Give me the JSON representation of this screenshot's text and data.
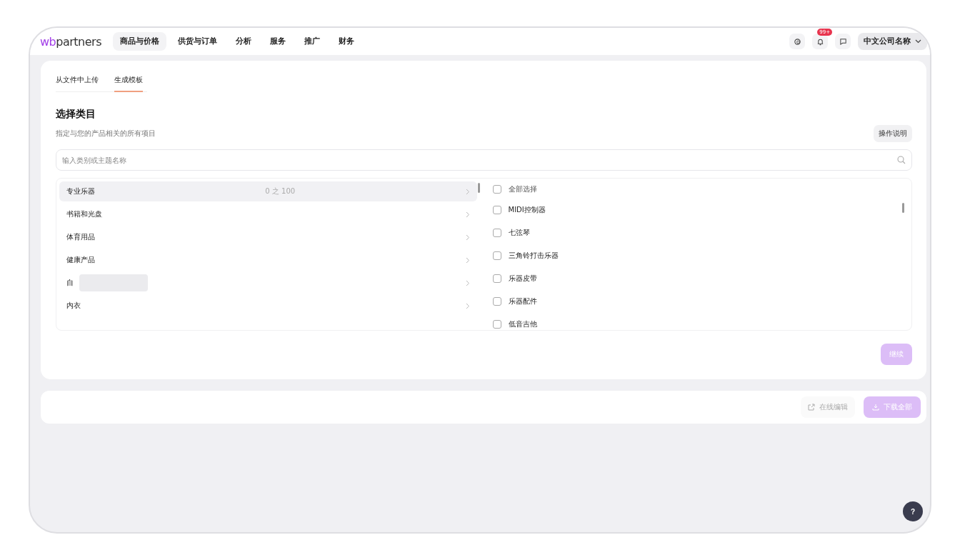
{
  "header": {
    "logo": {
      "first": "wb",
      "rest": "partners"
    },
    "nav": [
      {
        "label": "商品与价格",
        "selected": true
      },
      {
        "label": "供货与订单",
        "selected": false
      },
      {
        "label": "分析",
        "selected": false
      },
      {
        "label": "服务",
        "selected": false
      },
      {
        "label": "推广",
        "selected": false
      },
      {
        "label": "财务",
        "selected": false
      }
    ],
    "notification_badge": "99+",
    "account": "中文公司名称"
  },
  "tabs": [
    {
      "label": "从文件中上传",
      "selected": false
    },
    {
      "label": "生成模板",
      "selected": true
    }
  ],
  "section": {
    "title": "选择类目",
    "subtitle": "指定与您的产品相关的所有项目",
    "help_button": "操作说明"
  },
  "search": {
    "placeholder": "输入类别或主题名称"
  },
  "categories": [
    {
      "label": "专业乐器",
      "selected": true,
      "count": "0 之 100"
    },
    {
      "label": "书籍和光盘",
      "selected": false
    },
    {
      "label": "体育用品",
      "selected": false
    },
    {
      "label": "健康产品",
      "selected": false
    },
    {
      "label": "自",
      "selected": false,
      "redacted": true
    },
    {
      "label": "内衣",
      "selected": false
    }
  ],
  "subcategories": [
    {
      "label": "全部选择",
      "checked": false,
      "kind": "all"
    },
    {
      "label": "MIDI控制器",
      "checked": false,
      "kind": "item"
    },
    {
      "label": "七弦琴",
      "checked": false,
      "kind": "item"
    },
    {
      "label": "三角铃打击乐器",
      "checked": false,
      "kind": "item"
    },
    {
      "label": "乐器皮带",
      "checked": false,
      "kind": "item"
    },
    {
      "label": "乐器配件",
      "checked": false,
      "kind": "item"
    },
    {
      "label": "低音吉他",
      "checked": false,
      "kind": "item"
    }
  ],
  "continue_button": {
    "label": "继续",
    "disabled": true
  },
  "footer": {
    "edit_online": "在线编辑",
    "download_all": {
      "label": "下载全部",
      "disabled": true
    }
  },
  "help_fab": "?"
}
